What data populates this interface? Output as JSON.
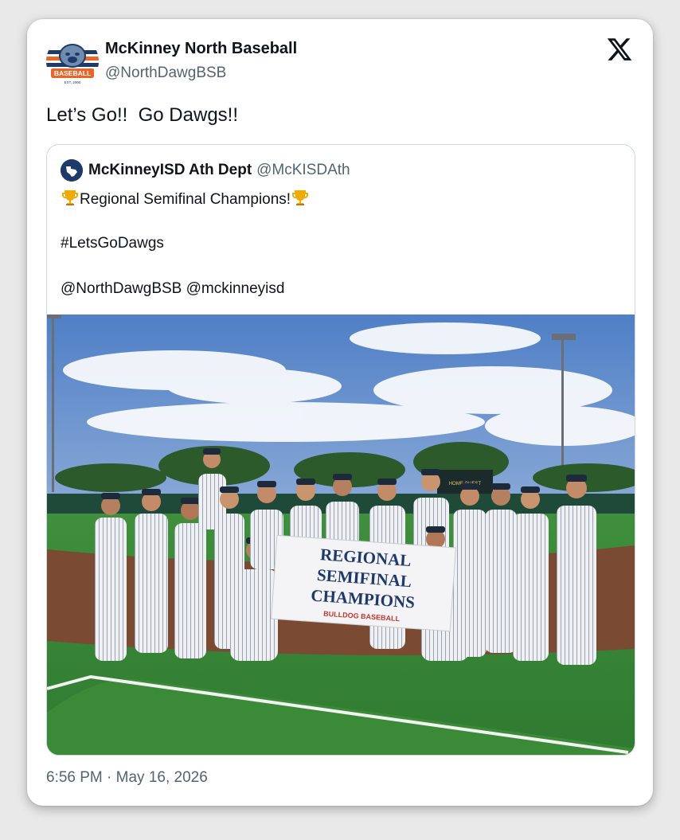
{
  "post": {
    "display_name": "McKinney North Baseball",
    "handle": "@NorthDawgBSB",
    "text": "Let’s Go!!  Go Dawgs!!",
    "timestamp": "6:56 PM · May 16, 2026",
    "avatar": {
      "top_text": "BASEBALL",
      "bottom_text": "EST. 2000"
    }
  },
  "quote": {
    "display_name": "McKinneyISD Ath Dept",
    "handle": "@McKISDAth",
    "line1": "Regional Semifinal Champions!",
    "hashtag": "#LetsGoDawgs",
    "mentions": "@NorthDawgBSB @mckinneyisd"
  },
  "photo": {
    "banner_line1": "REGIONAL",
    "banner_line2": "SEMIFINAL",
    "banner_line3": "CHAMPIONS",
    "banner_footer": "BULLDOG BASEBALL",
    "scoreboard": "HOME  GUEST"
  },
  "colors": {
    "accent_navy": "#1f3a68",
    "accent_orange": "#e8662a",
    "text_secondary": "#536471"
  },
  "icons": [
    "bulldog-logo",
    "x-logo-icon",
    "trophy-icon",
    "texas-logo"
  ]
}
